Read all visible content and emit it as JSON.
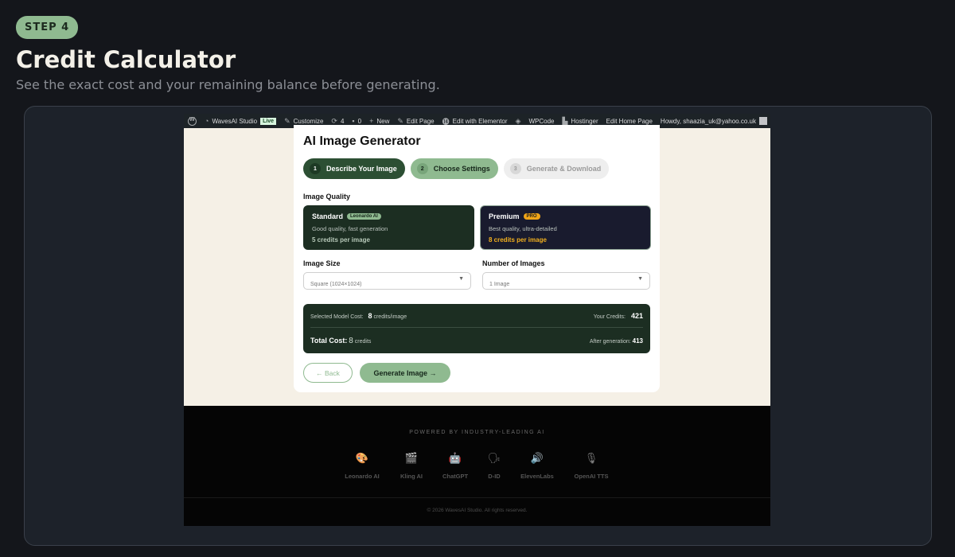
{
  "header": {
    "step": "STEP 4",
    "title": "Credit Calculator",
    "subtitle": "See the exact cost and your remaining balance before generating."
  },
  "wpbar": {
    "site": "WavesAI Studio",
    "live": "Live",
    "customize": "Customize",
    "updates": "4",
    "comments": "0",
    "new": "New",
    "edit_page": "Edit Page",
    "edit_elementor": "Edit with Elementor",
    "wpcode": "WPCode",
    "hostinger": "Hostinger",
    "edit_home": "Edit Home Page",
    "howdy": "Howdy, shaazia_uk@yahoo.co.uk"
  },
  "generator": {
    "title": "AI Image Generator",
    "steps": [
      {
        "num": "1",
        "label": "Describe Your Image"
      },
      {
        "num": "2",
        "label": "Choose Settings"
      },
      {
        "num": "3",
        "label": "Generate & Download"
      }
    ],
    "quality_label": "Image Quality",
    "standard": {
      "name": "Standard",
      "tag": "Leonardo AI",
      "desc": "Good quality, fast generation",
      "credits": "5 credits per image"
    },
    "premium": {
      "name": "Premium",
      "tag": "PRO",
      "desc": "Best quality, ultra-detailed",
      "credits": "8 credits per image"
    },
    "size_label": "Image Size",
    "size_value": "Square (1024×1024)",
    "count_label": "Number of Images",
    "count_value": "1 Image",
    "cost": {
      "model_cost_label": "Selected Model Cost:",
      "model_cost_value": "8",
      "model_cost_unit": "credits/image",
      "your_credits_label": "Your Credits:",
      "your_credits_value": "421",
      "total_label": "Total Cost:",
      "total_value": "8",
      "total_unit": "credits",
      "after_label": "After generation:",
      "after_value": "413"
    },
    "back_label": "← Back",
    "generate_label": "Generate Image →"
  },
  "footer": {
    "powered": "POWERED BY INDUSTRY-LEADING AI",
    "brands": [
      {
        "name": "Leonardo AI",
        "icon": "palette-icon"
      },
      {
        "name": "Kling AI",
        "icon": "clapper-icon"
      },
      {
        "name": "ChatGPT",
        "icon": "robot-icon"
      },
      {
        "name": "D-ID",
        "icon": "speaking-head-icon"
      },
      {
        "name": "ElevenLabs",
        "icon": "speaker-icon"
      },
      {
        "name": "OpenAI TTS",
        "icon": "microphone-icon"
      }
    ],
    "copyright": "© 2026 WavesAI Studio. All rights reserved."
  }
}
